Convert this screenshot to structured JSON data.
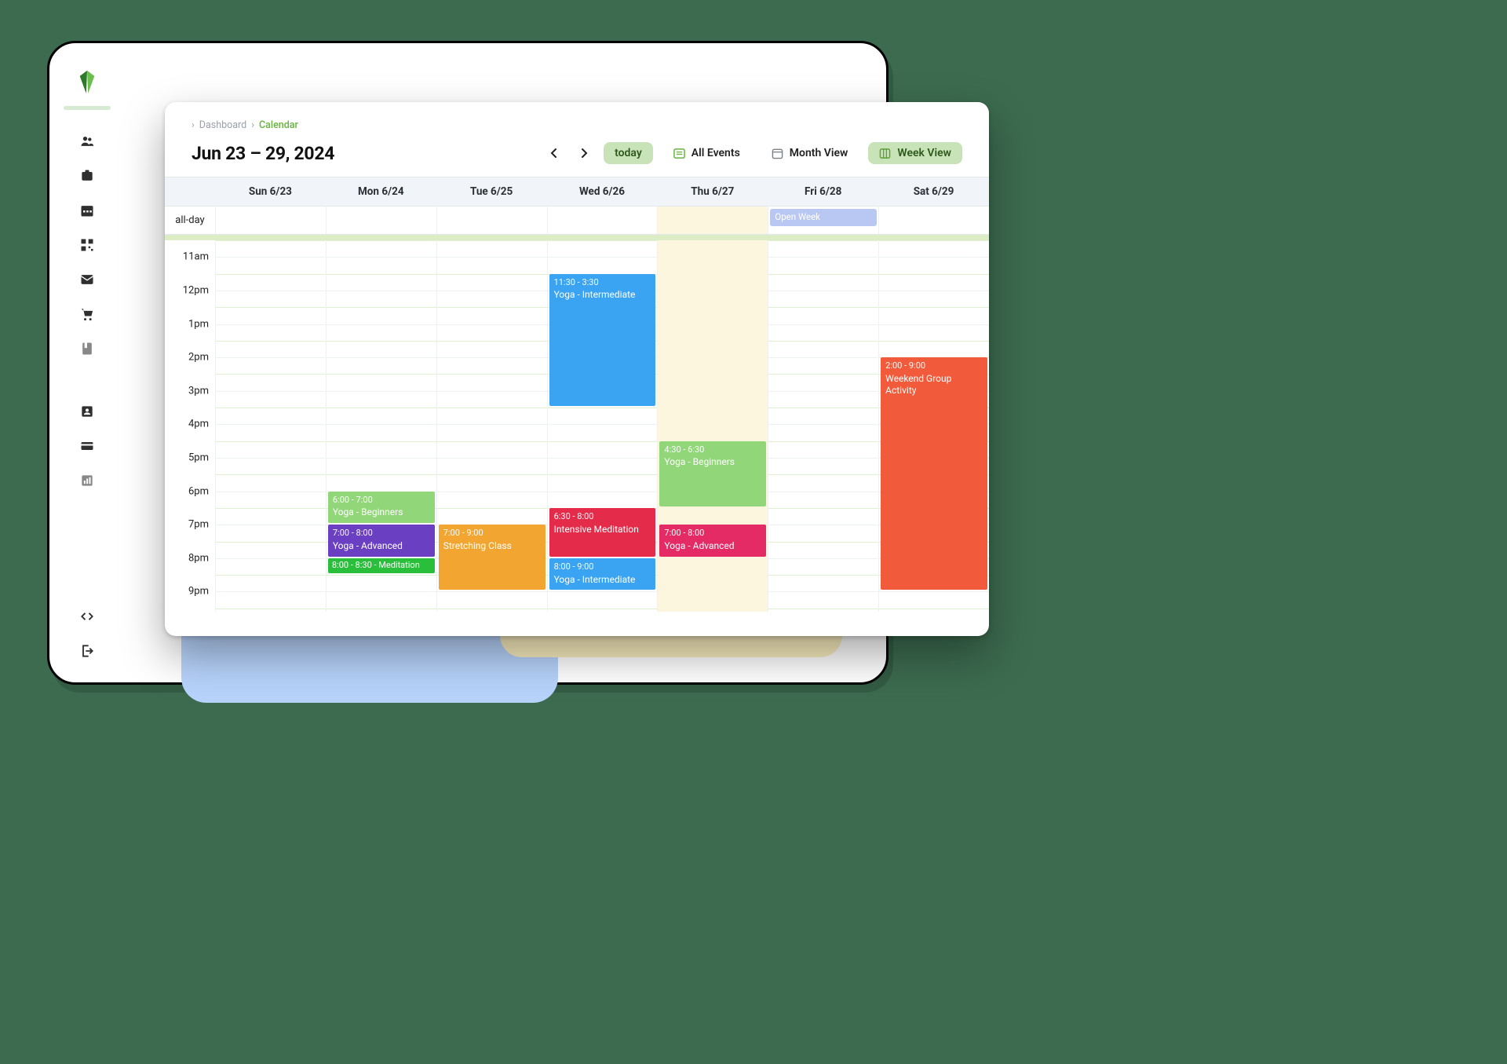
{
  "breadcrumb": {
    "root": "Dashboard",
    "current": "Calendar"
  },
  "header": {
    "date_range": "Jun 23 – 29, 2024",
    "today_label": "today",
    "all_events_label": "All Events",
    "month_view_label": "Month View",
    "week_view_label": "Week View"
  },
  "days": {
    "allday_label": "all-day",
    "cols": [
      "Sun 6/23",
      "Mon 6/24",
      "Tue 6/25",
      "Wed 6/26",
      "Thu 6/27",
      "Fri 6/28",
      "Sat 6/29"
    ]
  },
  "today_index": 4,
  "time_axis": {
    "start_hour": 10.5,
    "end_hour": 21.6,
    "labels": [
      {
        "h": 11,
        "t": "11am"
      },
      {
        "h": 12,
        "t": "12pm"
      },
      {
        "h": 13,
        "t": "1pm"
      },
      {
        "h": 14,
        "t": "2pm"
      },
      {
        "h": 15,
        "t": "3pm"
      },
      {
        "h": 16,
        "t": "4pm"
      },
      {
        "h": 17,
        "t": "5pm"
      },
      {
        "h": 18,
        "t": "6pm"
      },
      {
        "h": 19,
        "t": "7pm"
      },
      {
        "h": 20,
        "t": "8pm"
      },
      {
        "h": 21,
        "t": "9pm"
      }
    ]
  },
  "allday_events": [
    {
      "day": 5,
      "title": "Open Week",
      "color": "#b8c8f2"
    }
  ],
  "events": [
    {
      "day": 3,
      "start": 11.5,
      "end": 15.5,
      "time": "11:30 - 3:30",
      "title": "Yoga - Intermediate",
      "color": "#3aa3f2"
    },
    {
      "day": 6,
      "start": 14,
      "end": 21,
      "time": "2:00 - 9:00",
      "title": "Weekend Group Activity",
      "color": "#f15a3a"
    },
    {
      "day": 4,
      "start": 16.5,
      "end": 18.5,
      "time": "4:30 - 6:30",
      "title": "Yoga - Beginners",
      "color": "#92d67a"
    },
    {
      "day": 1,
      "start": 18,
      "end": 19,
      "time": "6:00 - 7:00",
      "title": "Yoga - Beginners",
      "color": "#92d67a"
    },
    {
      "day": 3,
      "start": 18.5,
      "end": 20,
      "time": "6:30 - 8:00",
      "title": "Intensive Meditation",
      "color": "#e52b4a"
    },
    {
      "day": 1,
      "start": 19,
      "end": 20,
      "time": "7:00 - 8:00",
      "title": "Yoga - Advanced",
      "color": "#6a3fc2"
    },
    {
      "day": 2,
      "start": 19,
      "end": 21,
      "time": "7:00 - 9:00",
      "title": "Stretching Class",
      "color": "#f2a531"
    },
    {
      "day": 4,
      "start": 19,
      "end": 20,
      "time": "7:00 - 8:00",
      "title": "Yoga - Advanced",
      "color": "#e52b66"
    },
    {
      "day": 1,
      "start": 20,
      "end": 20.5,
      "time": "8:00 - 8:30 - Meditation",
      "title": "",
      "color": "#2abf3a",
      "mini": true
    },
    {
      "day": 3,
      "start": 20,
      "end": 21,
      "time": "8:00 - 9:00",
      "title": "Yoga - Intermediate",
      "color": "#3aa3f2"
    }
  ],
  "sidebar_icons": [
    "people-icon",
    "badge-icon",
    "calendar-icon",
    "qr-icon",
    "mail-icon",
    "cart-icon",
    "bookmark-icon"
  ],
  "sidebar_icons_mid": [
    "person-box-icon",
    "card-icon",
    "stats-icon"
  ],
  "sidebar_icons_bottom": [
    "code-icon",
    "logout-icon"
  ]
}
